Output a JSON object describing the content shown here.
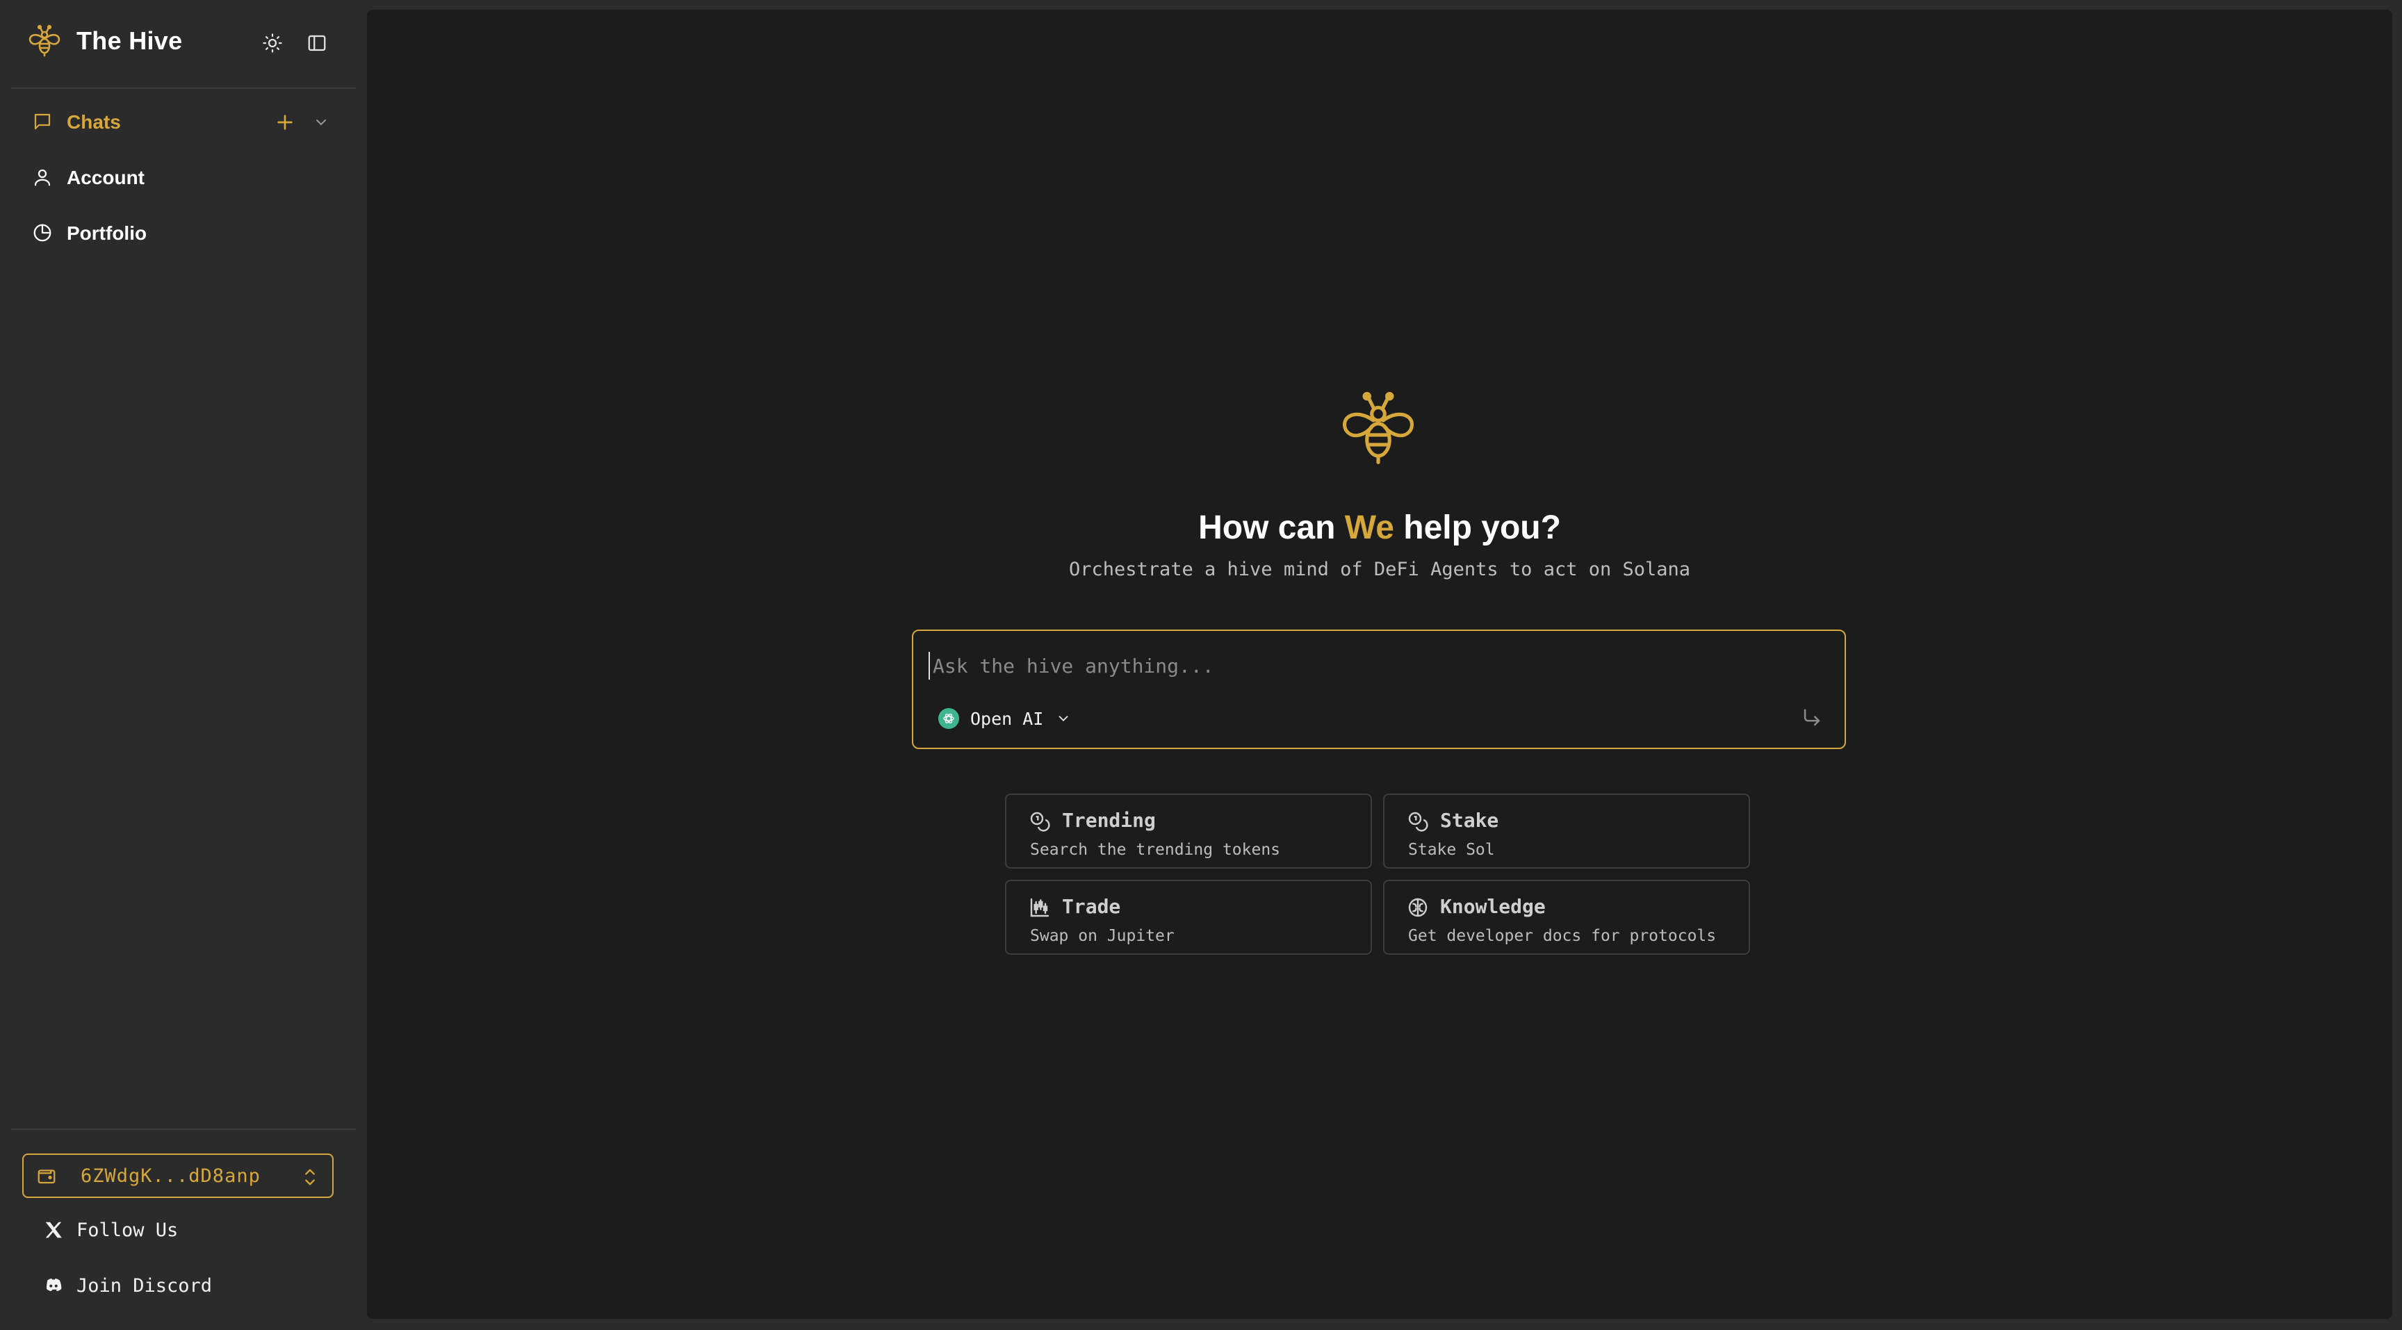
{
  "app": {
    "title": "The Hive"
  },
  "colors": {
    "accent": "#d6a83c",
    "sidebar_bg": "#2b2b2b",
    "main_bg": "#1c1c1c",
    "openai_green": "#3fb58f"
  },
  "sidebar": {
    "items": [
      {
        "label": "Chats",
        "icon": "message-square-icon",
        "active": true
      },
      {
        "label": "Account",
        "icon": "user-icon"
      },
      {
        "label": "Portfolio",
        "icon": "pie-chart-icon"
      }
    ],
    "wallet": {
      "address": "6ZWdgK...dD8anp",
      "icon": "wallet-icon"
    },
    "footer_links": [
      {
        "label": "Follow Us",
        "icon": "x-logo-icon"
      },
      {
        "label": "Join Discord",
        "icon": "discord-icon"
      }
    ]
  },
  "main": {
    "headline_before": "How can ",
    "headline_accent": "We",
    "headline_after": " help you?",
    "subtitle": "Orchestrate a hive mind of DeFi Agents to act on Solana",
    "input": {
      "placeholder": "Ask the hive anything...",
      "value": ""
    },
    "model": {
      "label": "Open AI",
      "icon": "openai-icon"
    },
    "suggestions": [
      {
        "title": "Trending",
        "description": "Search the trending tokens",
        "icon": "coins-icon"
      },
      {
        "title": "Stake",
        "description": "Stake Sol",
        "icon": "coins-icon"
      },
      {
        "title": "Trade",
        "description": "Swap on Jupiter",
        "icon": "chart-candlestick-icon"
      },
      {
        "title": "Knowledge",
        "description": "Get developer docs for protocols",
        "icon": "brain-icon"
      }
    ]
  }
}
